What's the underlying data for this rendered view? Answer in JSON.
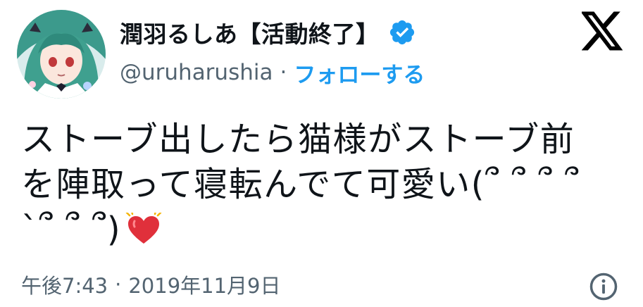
{
  "author": {
    "display_name": "潤羽るしあ【活動終了】",
    "handle": "@uruharushia",
    "follow_label": "フォローする",
    "separator": "·",
    "verified": true
  },
  "tweet": {
    "line1": "ストーブ出したら猫様がストーブ前",
    "line2": "を陣取って寝転んでて可愛い(՞ ՞ ՞ ՞",
    "line3": "`՞ ՞ ՞)",
    "emoji": "beating-heart-emoji"
  },
  "meta": {
    "time": "午後7:43",
    "separator": "·",
    "date": "2019年11月9日"
  },
  "colors": {
    "accent": "#1d9bf0",
    "secondary_text": "#536471",
    "primary_text": "#0f1419",
    "heart": "#e0303b"
  },
  "icons": [
    "avatar",
    "verified-badge-icon",
    "x-logo-icon",
    "info-icon",
    "heart-emoji"
  ]
}
